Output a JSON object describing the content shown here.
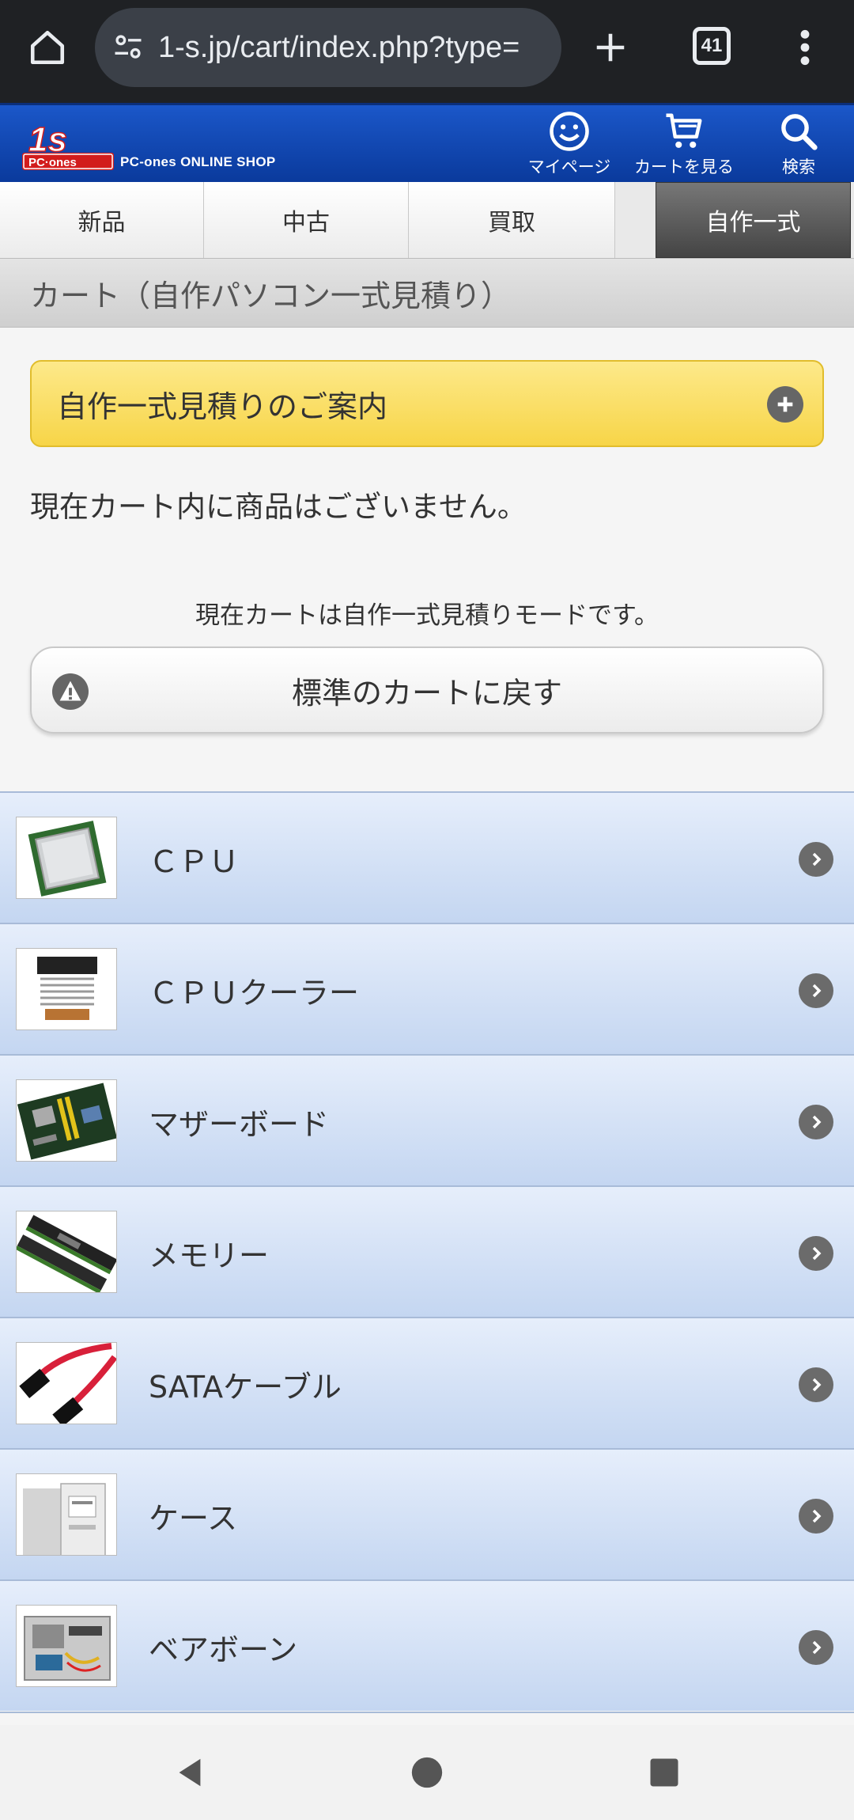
{
  "browser": {
    "url": "1-s.jp/cart/index.php?type=",
    "tab_count": "41"
  },
  "header": {
    "logo_text": "PC-ones ONLINE SHOP",
    "mypage_label": "マイページ",
    "cart_label": "カートを見る",
    "search_label": "検索"
  },
  "category_tabs": [
    {
      "label": "新品"
    },
    {
      "label": "中古"
    },
    {
      "label": "買取"
    },
    {
      "label": "自作一式"
    }
  ],
  "page_title": "カート（自作パソコン一式見積り）",
  "guide": {
    "label": "自作一式見積りのご案内"
  },
  "empty_message": "現在カート内に商品はございません。",
  "mode_message": "現在カートは自作一式見積りモードです。",
  "back_button": {
    "label": "標準のカートに戻す"
  },
  "parts": [
    {
      "label": "ＣＰＵ",
      "icon": "cpu-image"
    },
    {
      "label": "ＣＰＵクーラー",
      "icon": "cpu-cooler-image"
    },
    {
      "label": "マザーボード",
      "icon": "motherboard-image"
    },
    {
      "label": "メモリー",
      "icon": "memory-image"
    },
    {
      "label": "SATAケーブル",
      "icon": "sata-cable-image"
    },
    {
      "label": "ケース",
      "icon": "case-image"
    },
    {
      "label": "ベアボーン",
      "icon": "barebone-image"
    }
  ],
  "colors": {
    "header_blue": "#0a3a9c",
    "guide_yellow": "#f7d548",
    "row_blue": "#c4d6f1"
  }
}
